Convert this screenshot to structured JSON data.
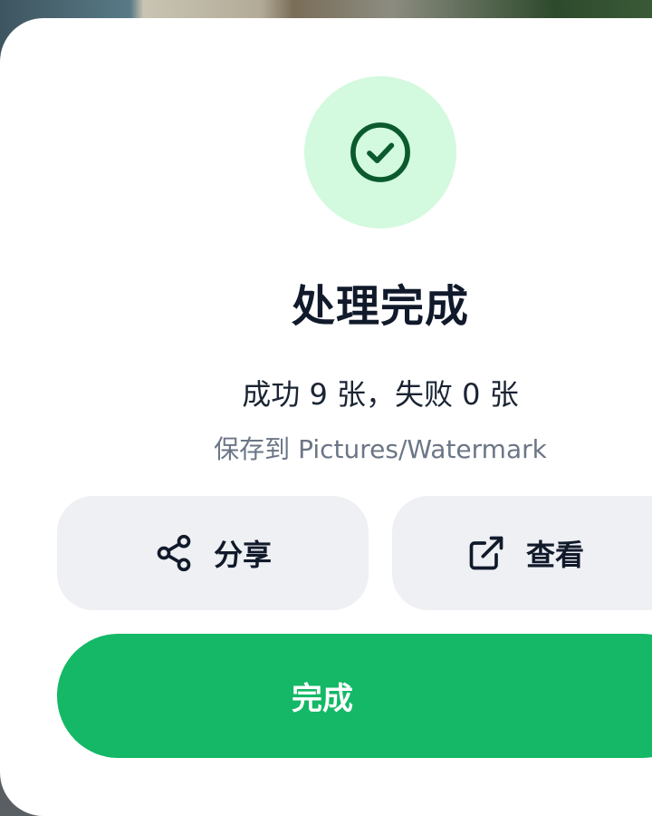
{
  "dialog": {
    "title": "处理完成",
    "summary": "成功 9 张，失败 0 张",
    "save_path": "保存到 Pictures/Watermark"
  },
  "actions": {
    "share_label": "分享",
    "view_label": "查看",
    "done_label": "完成"
  },
  "icons": {
    "success": "check-circle-icon",
    "share": "share-icon",
    "view": "external-link-icon"
  },
  "colors": {
    "accent": "#14b866",
    "success_bg": "#d3f9df",
    "success_fg": "#0b5a2e",
    "secondary_button_bg": "#eff0f3"
  }
}
